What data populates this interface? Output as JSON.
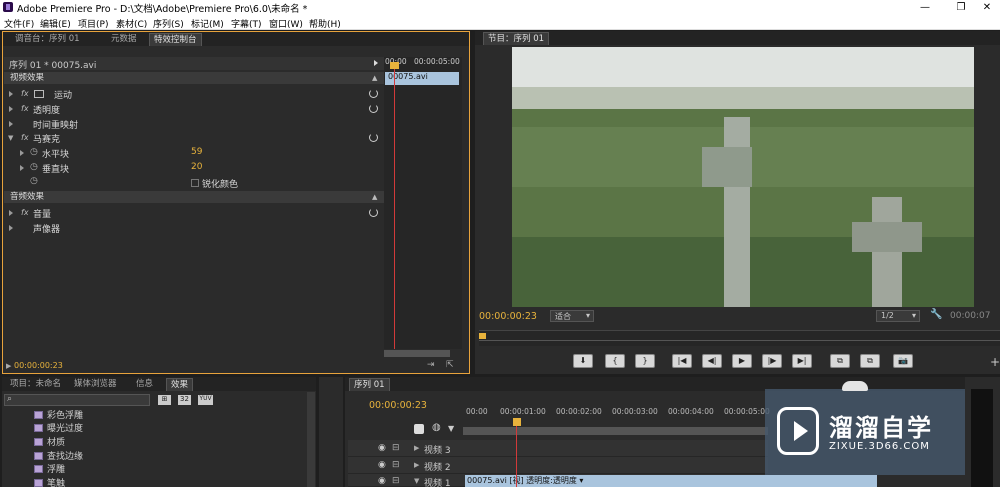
{
  "window": {
    "title": "Adobe Premiere Pro - D:\\文档\\Adobe\\Premiere Pro\\6.0\\未命名 *",
    "minimize": "—",
    "restore": "❐",
    "close": "✕"
  },
  "menu": [
    "文件(F)",
    "编辑(E)",
    "项目(P)",
    "素材(C)",
    "序列(S)",
    "标记(M)",
    "字幕(T)",
    "窗口(W)",
    "帮助(H)"
  ],
  "source_panel": {
    "tabs": [
      "调音台：序列 01",
      "元数据",
      "特效控制台"
    ],
    "clip_label": "序列 01 * 00075.avi",
    "ruler": [
      "00:00",
      "00:00:05:00"
    ],
    "clip_chip": "00075.avi",
    "video_effects_header": "视频效果",
    "effects": [
      {
        "name": "运动",
        "fx": "fx"
      },
      {
        "name": "透明度",
        "fx": "fx"
      },
      {
        "name": "时间重映射",
        "fx": ""
      },
      {
        "name": "马赛克",
        "fx": "fx"
      }
    ],
    "mosaic_params": [
      {
        "name": "水平块",
        "value": "59"
      },
      {
        "name": "垂直块",
        "value": "20"
      },
      {
        "name": "锐化颜色",
        "value": ""
      }
    ],
    "audio_effects_header": "音频效果",
    "audio_effects": [
      {
        "name": "音量",
        "fx": "fx"
      },
      {
        "name": "声像器",
        "fx": ""
      }
    ],
    "timecode": "00:00:00:23"
  },
  "program_panel": {
    "tab": "节目：序列 01",
    "timecode": "00:00:00:23",
    "fit": "适合",
    "resolution": "1/2",
    "duration": "00:00:07",
    "buttons": [
      "⬇",
      "{",
      "}",
      "|◀",
      "◀|",
      "▶",
      "|▶",
      "▶|",
      "⧉",
      "⧉",
      "📷"
    ]
  },
  "project_panel": {
    "tabs": [
      "项目：未命名",
      "媒体浏览器",
      "信息",
      "效果"
    ],
    "items": [
      "彩色浮雕",
      "曝光过度",
      "材质",
      "查找边缘",
      "浮雕",
      "笔触"
    ],
    "badges": [
      "32",
      "YUV"
    ]
  },
  "timeline": {
    "tab": "序列 01",
    "timecode": "00:00:00:23",
    "ruler": [
      "00:00",
      "00:00:01:00",
      "00:00:02:00",
      "00:00:03:00",
      "00:00:04:00",
      "00:00:05:00"
    ],
    "tracks": [
      "视频 3",
      "视频 2",
      "视频 1"
    ],
    "clip": "00075.avi [视] 透明度:透明度 ▾"
  },
  "watermark": {
    "text": "溜溜自学",
    "url": "ZIXUE.3D66.COM"
  },
  "colors": {
    "accent": "#e8b33c",
    "playhead": "#d23a3a",
    "panel": "#2b2b2b",
    "clip": "#a9c4dd"
  }
}
